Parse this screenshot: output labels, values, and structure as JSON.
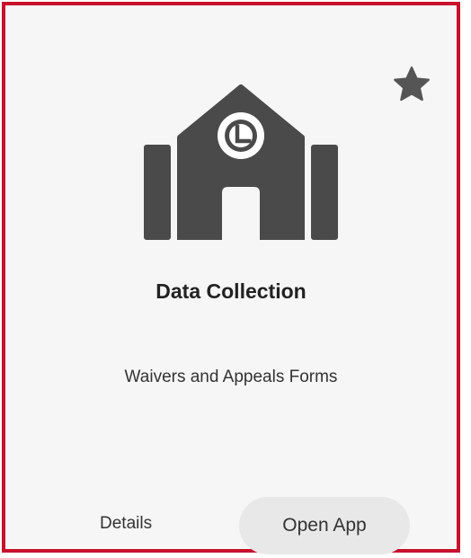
{
  "card": {
    "title": "Data Collection",
    "subtitle": "Waivers and Appeals Forms",
    "favorite_icon": "star-icon",
    "app_icon": "school-building-clock-icon",
    "details_label": "Details",
    "open_label": "Open App"
  },
  "colors": {
    "border": "#c8102e",
    "background": "#f6f6f6",
    "icon": "#4a4a4a",
    "button_bg": "#e8e8e8"
  }
}
